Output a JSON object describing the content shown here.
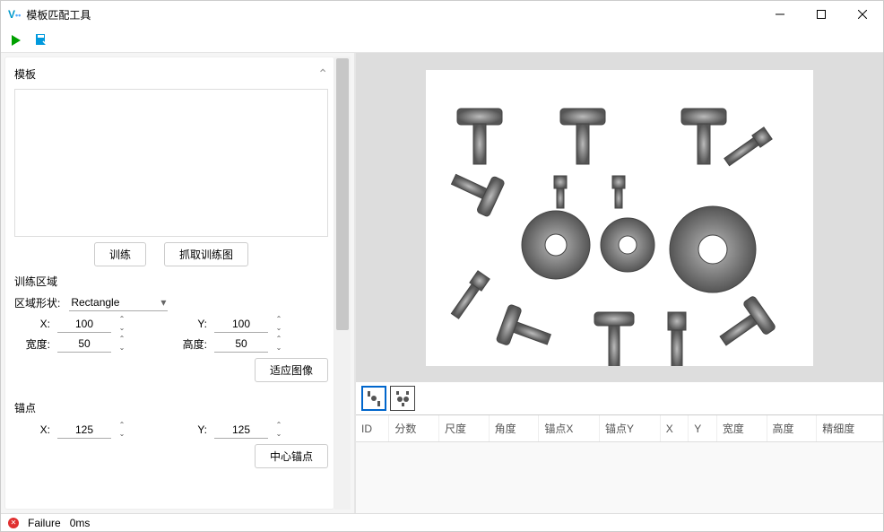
{
  "window": {
    "title": "模板匹配工具"
  },
  "toolbar": {},
  "panels": {
    "template": {
      "header": "模板",
      "train_btn": "训练",
      "capture_btn": "抓取训练图"
    },
    "train_region": {
      "header": "训练区域",
      "shape_label": "区域形状:",
      "shape_value": "Rectangle",
      "x_label": "X:",
      "x_value": "100",
      "y_label": "Y:",
      "y_value": "100",
      "w_label": "宽度:",
      "w_value": "50",
      "h_label": "高度:",
      "h_value": "50",
      "fit_btn": "适应图像"
    },
    "anchor": {
      "header": "锚点",
      "x_label": "X:",
      "x_value": "125",
      "y_label": "Y:",
      "y_value": "125",
      "center_btn": "中心锚点"
    }
  },
  "results": {
    "columns": [
      "ID",
      "分数",
      "尺度",
      "角度",
      "锚点X",
      "锚点Y",
      "X",
      "Y",
      "宽度",
      "高度",
      "精细度"
    ]
  },
  "status": {
    "state": "Failure",
    "time": "0ms"
  }
}
